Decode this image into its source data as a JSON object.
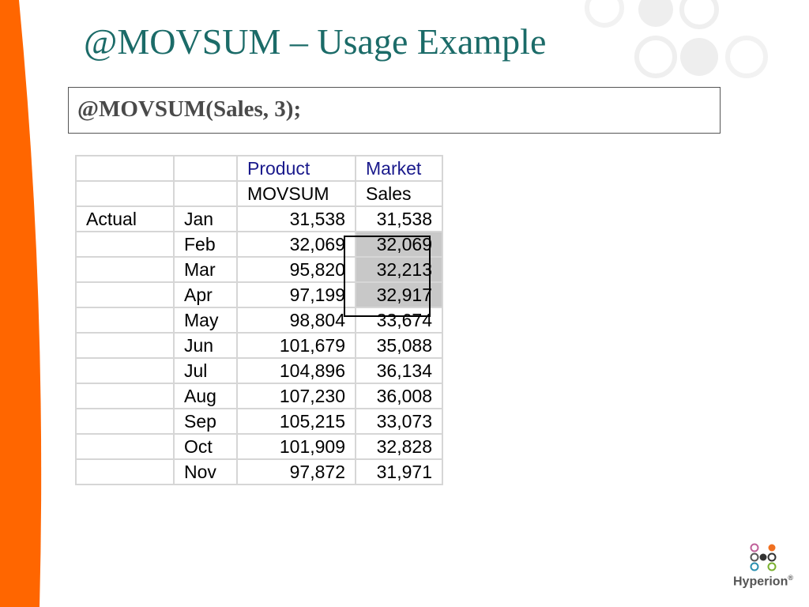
{
  "slide": {
    "title": "@MOVSUM – Usage Example",
    "formula": "@MOVSUM(Sales, 3);"
  },
  "table": {
    "header1": [
      "",
      "",
      "Product",
      "Market"
    ],
    "header2": [
      "",
      "",
      "MOVSUM",
      "Sales"
    ],
    "scenario": "Actual",
    "rows": [
      {
        "month": "Jan",
        "movsum": "31,538",
        "sales": "31,538"
      },
      {
        "month": "Feb",
        "movsum": "32,069",
        "sales": "32,069"
      },
      {
        "month": "Mar",
        "movsum": "95,820",
        "sales": "32,213"
      },
      {
        "month": "Apr",
        "movsum": "97,199",
        "sales": "32,917"
      },
      {
        "month": "May",
        "movsum": "98,804",
        "sales": "33,674"
      },
      {
        "month": "Jun",
        "movsum": "101,679",
        "sales": "35,088"
      },
      {
        "month": "Jul",
        "movsum": "104,896",
        "sales": "36,134"
      },
      {
        "month": "Aug",
        "movsum": "107,230",
        "sales": "36,008"
      },
      {
        "month": "Sep",
        "movsum": "105,215",
        "sales": "33,073"
      },
      {
        "month": "Oct",
        "movsum": "101,909",
        "sales": "32,828"
      },
      {
        "month": "Nov",
        "movsum": "97,872",
        "sales": "31,971"
      }
    ],
    "highlighted_rows": [
      "Feb",
      "Mar",
      "Apr"
    ]
  },
  "logo": {
    "text": "Hyperion",
    "mark": "®"
  },
  "colors": {
    "accent_orange": "#ff6600",
    "title_teal": "#1b6b68",
    "header_blue": "#1a1a8c",
    "highlight_gray": "#c8c8c8"
  }
}
